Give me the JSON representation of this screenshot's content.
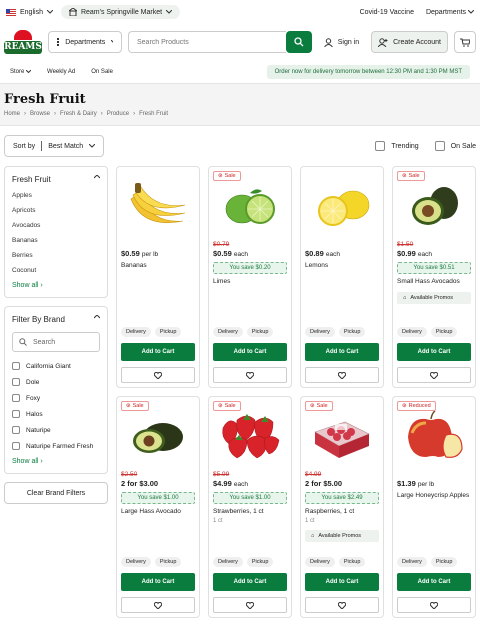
{
  "topbar": {
    "language": "English",
    "store": "Ream's Springville Market",
    "links": [
      "Covid-19 Vaccine",
      "Departments"
    ]
  },
  "header": {
    "logo_text": "REAMS",
    "departments_label": "Departments",
    "search_placeholder": "Search Products",
    "sign_in": "Sign in",
    "create_account": "Create Account"
  },
  "nav": {
    "items": [
      "Store",
      "Weekly Ad",
      "On Sale"
    ],
    "order_banner": "Order now for delivery tomorrow between 12:30 PM and 1:30 PM MST"
  },
  "page": {
    "title": "Fresh Fruit",
    "breadcrumb": [
      "Home",
      "Browse",
      "Fresh & Dairy",
      "Produce",
      "Fresh Fruit"
    ]
  },
  "sort": {
    "label": "Sort by",
    "value": "Best Match",
    "filters": [
      "Trending",
      "On Sale"
    ]
  },
  "sidebar": {
    "category_title": "Fresh Fruit",
    "categories": [
      "Apples",
      "Apricots",
      "Avocados",
      "Bananas",
      "Berries",
      "Coconut"
    ],
    "show_all": "Show all",
    "brand_title": "Filter By Brand",
    "brand_search_placeholder": "Search",
    "brands": [
      "California Giant",
      "Dole",
      "Foxy",
      "Halos",
      "Naturipe",
      "Naturipe Farmed Fresh"
    ],
    "clear_label": "Clear Brand Filters"
  },
  "labels": {
    "delivery": "Delivery",
    "pickup": "Pickup",
    "add_to_cart": "Add to Cart",
    "available_promos": "Available Promos"
  },
  "products": [
    {
      "name": "Bananas",
      "price": "$0.59",
      "unit": "per lb",
      "was": "",
      "badge": "",
      "save": "",
      "sub": "",
      "promo": false
    },
    {
      "name": "Limes",
      "price": "$0.59",
      "unit": "each",
      "was": "$0.79",
      "badge": "Sale",
      "save": "You save $0.20",
      "sub": "",
      "promo": false
    },
    {
      "name": "Lemons",
      "price": "$0.89",
      "unit": "each",
      "was": "",
      "badge": "",
      "save": "",
      "sub": "",
      "promo": false
    },
    {
      "name": "Small Hass Avocados",
      "price": "$0.99",
      "unit": "each",
      "was": "$1.50",
      "badge": "Sale",
      "save": "You save $0.51",
      "sub": "",
      "promo": true
    },
    {
      "name": "Large Hass Avocado",
      "price": "2 for $3.00",
      "unit": "",
      "was": "$2.50",
      "badge": "Sale",
      "save": "You save $1.00",
      "sub": "",
      "promo": false
    },
    {
      "name": "Strawberries, 1 ct",
      "price": "$4.99",
      "unit": "each",
      "was": "$5.99",
      "badge": "Sale",
      "save": "You save $1.00",
      "sub": "1 ct",
      "promo": false
    },
    {
      "name": "Raspberries, 1 ct",
      "price": "2 for $5.00",
      "unit": "",
      "was": "$4.99",
      "badge": "Sale",
      "save": "You save $2.49",
      "sub": "1 ct",
      "promo": true
    },
    {
      "name": "Large Honeycrisp Apples",
      "price": "$1.39",
      "unit": "per lb",
      "was": "",
      "badge": "Reduced",
      "save": "",
      "sub": "",
      "promo": false
    }
  ]
}
